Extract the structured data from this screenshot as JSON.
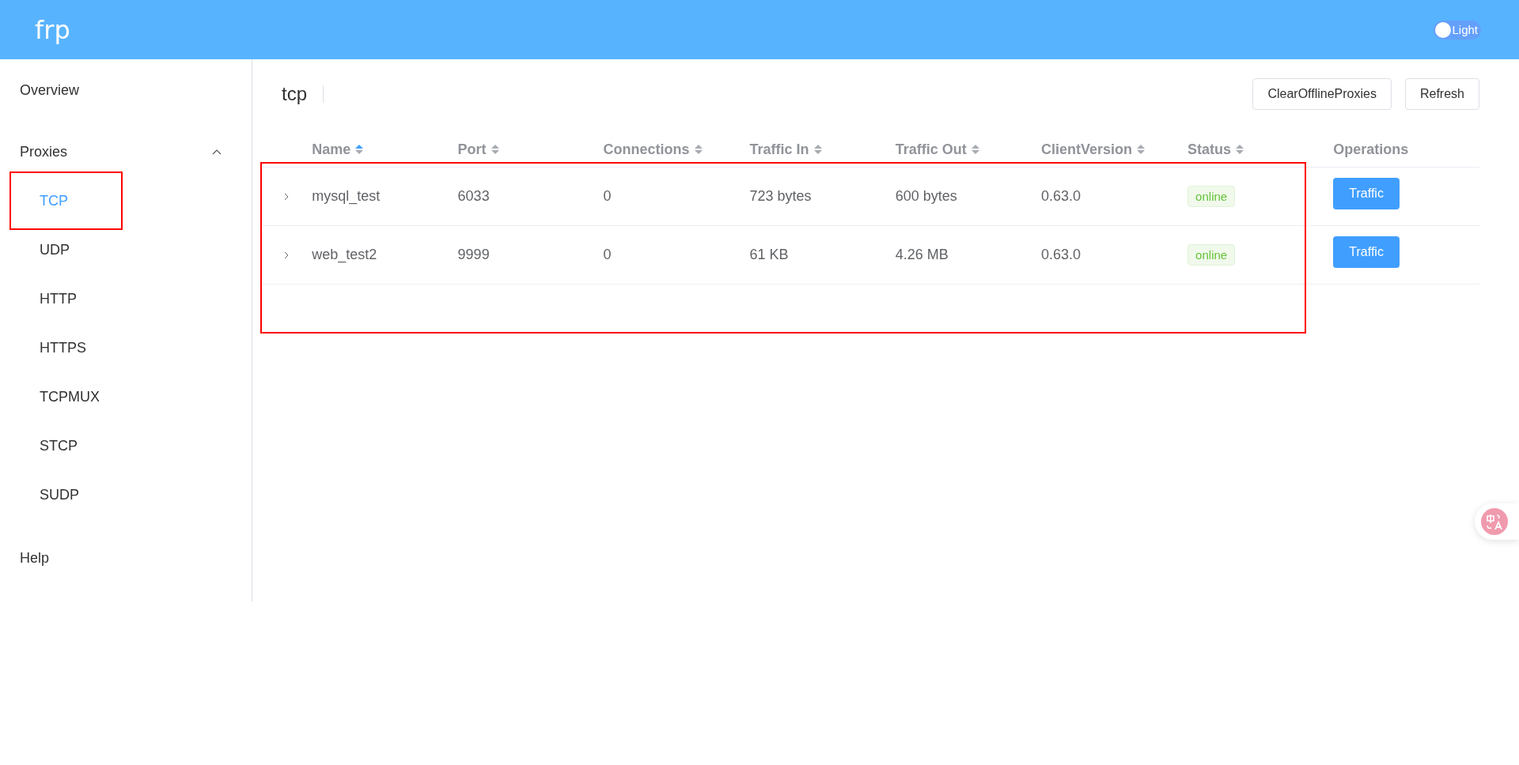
{
  "header": {
    "logo": "frp",
    "theme_toggle": {
      "label": "Light",
      "on": false
    }
  },
  "sidebar": {
    "items": [
      {
        "label": "Overview",
        "selected": false
      },
      {
        "label": "Proxies",
        "expanded": true,
        "children": [
          {
            "label": "TCP",
            "selected": true,
            "framed": true
          },
          {
            "label": "UDP",
            "selected": false,
            "framed": false
          },
          {
            "label": "HTTP",
            "selected": false,
            "framed": false
          },
          {
            "label": "HTTPS",
            "selected": false,
            "framed": false
          },
          {
            "label": "TCPMUX",
            "selected": false,
            "framed": false
          },
          {
            "label": "STCP",
            "selected": false,
            "framed": false
          },
          {
            "label": "SUDP",
            "selected": false,
            "framed": false
          }
        ]
      },
      {
        "label": "Help",
        "selected": false
      }
    ]
  },
  "page": {
    "title": "tcp",
    "buttons": [
      "ClearOfflineProxies",
      "Refresh"
    ]
  },
  "table": {
    "framed": true,
    "columns": [
      {
        "label": "Name",
        "sorted": true
      },
      {
        "label": "Port",
        "sorted": false
      },
      {
        "label": "Connections",
        "sorted": false
      },
      {
        "label": "Traffic In",
        "sorted": false
      },
      {
        "label": "Traffic Out",
        "sorted": false
      },
      {
        "label": "ClientVersion",
        "sorted": false
      },
      {
        "label": "Status",
        "sorted": false
      },
      {
        "label": "Operations"
      }
    ],
    "rows": [
      {
        "expanded": false,
        "cells": [
          "mysql_test",
          "6033",
          "0",
          "723 bytes",
          "600 bytes",
          "0.63.0"
        ],
        "status": "online",
        "action": "Traffic"
      },
      {
        "expanded": false,
        "cells": [
          "web_test2",
          "9999",
          "0",
          "61 KB",
          "4.26 MB",
          "0.63.0"
        ],
        "status": "online",
        "action": "Traffic"
      }
    ]
  }
}
